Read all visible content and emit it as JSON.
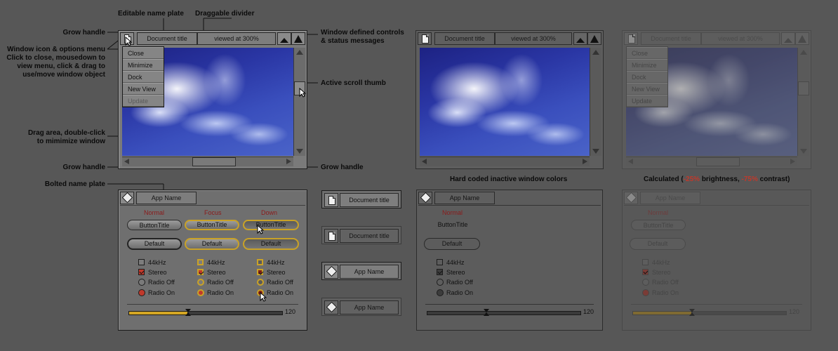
{
  "callouts": {
    "editable_name_plate": "Editable name plate",
    "draggable_divider": "Draggable divider",
    "grow_handle_top": "Grow handle",
    "window_icon_menu_1": "Window icon & options menu",
    "window_icon_menu_2": "Click to close, mousedown to",
    "window_icon_menu_3": "view menu, click & drag to",
    "window_icon_menu_4": "use/move window object",
    "window_defined_1": "Window defined controls",
    "window_defined_2": "& status messages",
    "active_scroll_thumb": "Active scroll thumb",
    "drag_area_1": "Drag area, double-click",
    "drag_area_2": "to mimimize window",
    "grow_handle_left": "Grow handle",
    "grow_handle_right": "Grow handle",
    "bolted_name_plate": "Bolted  name plate"
  },
  "captions": {
    "hard_coded": "Hard coded inactive window colors",
    "calc_prefix": "Calculated (",
    "calc_brightness": "-25%",
    "calc_mid": " brightness, ",
    "calc_contrast": "-75%",
    "calc_suffix": " contrast)"
  },
  "window": {
    "title": "Document title",
    "status": "viewed at 300%"
  },
  "window_menu": {
    "items": [
      "Close",
      "Minimize",
      "Dock",
      "New View",
      "Update"
    ]
  },
  "controls_panel": {
    "app_name": "App Name",
    "columns": [
      "Normal",
      "Focus",
      "Down"
    ],
    "button_title": "ButtonTitle",
    "default_label": "Default",
    "check_44": "44kHz",
    "check_stereo": "Stereo",
    "radio_off": "Radio Off",
    "radio_on": "Radio On",
    "slider_value": "120",
    "slider_level": 0.38
  },
  "samples": {
    "doc_title": "Document title",
    "app_name": "App Name"
  },
  "colors": {
    "background": "#575757",
    "accent_gold": "#c9a227",
    "accent_red": "#c0392b",
    "column_label": "#8b1a1a"
  },
  "icons": [
    "document-icon",
    "app-icon",
    "mountain-small-icon",
    "mountain-large-icon",
    "cursor-arrow-icon"
  ]
}
